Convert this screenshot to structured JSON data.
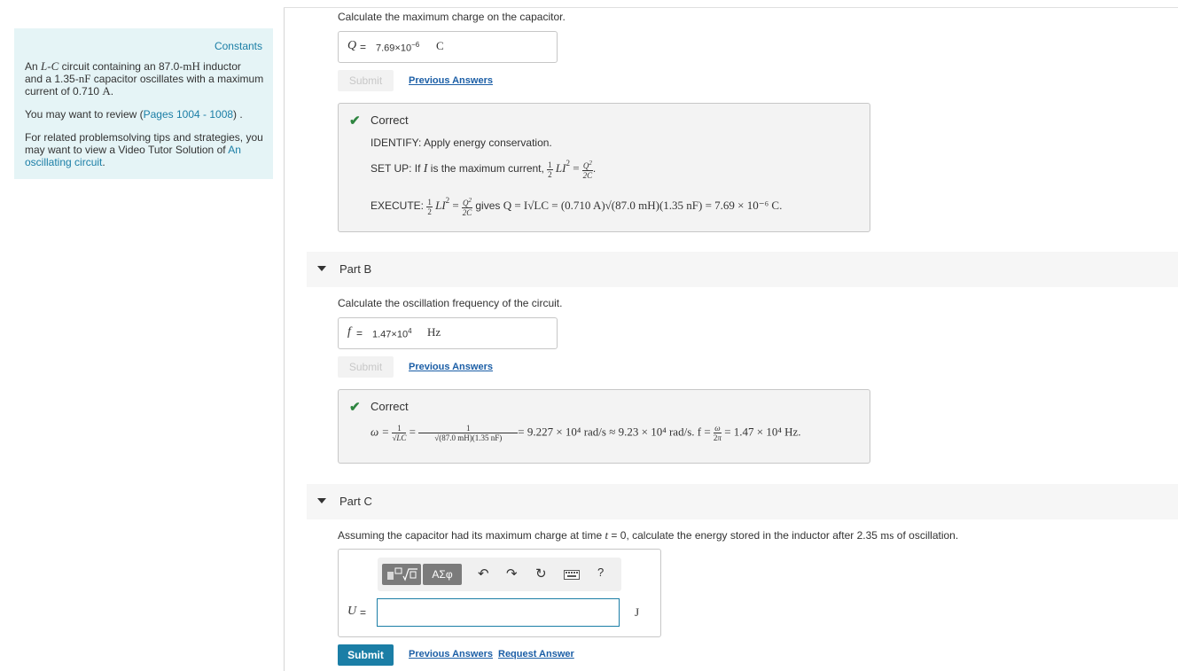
{
  "constants": {
    "title": "Constants",
    "problem_line1_pre": "An ",
    "problem_line1_circuit": "L-C",
    "problem_line1_post": " circuit containing an 87.0-",
    "problem_line1_unit": "mH",
    "problem_line1_tail": " inductor",
    "problem_line2_pre": "and a 1.35-",
    "problem_line2_unit": "nF",
    "problem_line2_post": " capacitor oscillates with a maximum",
    "problem_line3_pre": "current of 0.710 ",
    "problem_line3_unit": "A",
    "problem_line3_post": ".",
    "review_pre": "You may want to review (",
    "review_link": "Pages 1004 - 1008",
    "review_post": ") .",
    "tips_line1": "For related problemsolving tips and strategies, you",
    "tips_line2_pre": "may want to view a Video Tutor Solution of ",
    "tips_link1": "An",
    "tips_link2": "oscillating circuit",
    "tips_post": "."
  },
  "partA": {
    "prompt": "Calculate the maximum charge on the capacitor.",
    "var": "Q",
    "eq": "=",
    "value": "7.69×10",
    "exp": "−6",
    "unit": "C",
    "submit": "Submit",
    "previous": "Previous Answers",
    "correct": "Correct",
    "identify": "IDENTIFY: Apply energy conservation.",
    "setup_pre": "SET UP: If ",
    "setup_var": "I",
    "setup_post": " is the maximum current, ",
    "execute_pre": "EXECUTE: ",
    "execute_gives": " gives ",
    "execute_math": "Q = I√LC = (0.710 A)√(87.0 mH)(1.35 nF) = 7.69 × 10⁻⁶ C",
    "execute_end": "."
  },
  "partB": {
    "label": "Part B",
    "prompt": "Calculate the oscillation frequency of the circuit.",
    "var": "f",
    "eq": "=",
    "value": "1.47×10",
    "exp": "4",
    "unit": "Hz",
    "submit": "Submit",
    "previous": "Previous Answers",
    "correct": "Correct",
    "solution_tail": "= 9.227 × 10⁴ rad/s ≈ 9.23 × 10⁴ rad/s.  f = ",
    "solution_end": " = 1.47 × 10⁴ Hz."
  },
  "partC": {
    "label": "Part C",
    "prompt_pre": "Assuming the capacitor had its maximum charge at time ",
    "prompt_var": "t",
    "prompt_mid": " = 0, calculate the energy stored in the inductor after 2.35 ",
    "prompt_unit": "ms",
    "prompt_post": " of oscillation.",
    "var": "U",
    "eq": "=",
    "input_value": "",
    "unit": "J",
    "toolbar_greek": "ΑΣφ",
    "toolbar_help": "?",
    "submit": "Submit",
    "previous": "Previous Answers",
    "request": "Request Answer"
  },
  "colors": {
    "accent": "#1b7ea6",
    "panel": "#e5f4f6",
    "correct": "#2e8540"
  }
}
